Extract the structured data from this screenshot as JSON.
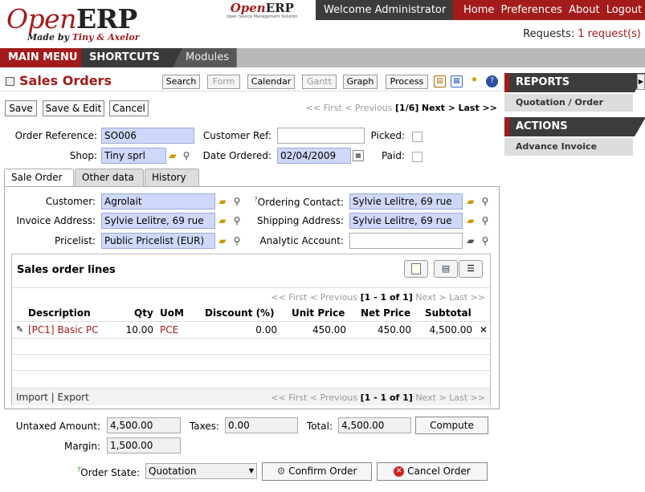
{
  "header": {
    "logo_open": "Open",
    "logo_erp": "ERP",
    "logo_made_by": "Made by ",
    "logo_tiny_axelor": "Tiny & Axelor",
    "mini_logo_open": "Open",
    "mini_logo_erp": "ERP",
    "mini_logo_tagline": "Open Source Management Solution",
    "welcome": "Welcome Administrator",
    "links": [
      "Home",
      "Preferences",
      "About",
      "Logout"
    ],
    "requests_label": "Requests:",
    "requests_value": "1 request(s)"
  },
  "menubar": {
    "main_menu": "MAIN MENU",
    "shortcuts": "SHORTCUTS",
    "modules": "Modules"
  },
  "view": {
    "title": "Sales Orders",
    "view_buttons": [
      "Search",
      "Form",
      "Calendar",
      "Gantt",
      "Graph",
      "Process"
    ],
    "disabled_buttons": [
      "Form",
      "Gantt"
    ]
  },
  "actions": {
    "save": "Save",
    "save_edit": "Save & Edit",
    "cancel": "Cancel",
    "pager_first": "<< First",
    "pager_prev": "< Previous",
    "pager_count": "[1/6]",
    "pager_next": "Next >",
    "pager_last": "Last >>"
  },
  "form": {
    "order_ref_label": "Order Reference:",
    "order_ref": "SO006",
    "customer_ref_label": "Customer Ref:",
    "customer_ref": "",
    "picked_label": "Picked:",
    "shop_label": "Shop:",
    "shop": "Tiny sprl",
    "date_ordered_label": "Date Ordered:",
    "date_ordered": "02/04/2009",
    "paid_label": "Paid:"
  },
  "tabs": [
    "Sale Order",
    "Other data",
    "History"
  ],
  "sale_order": {
    "customer_label": "Customer:",
    "customer": "Agrolait",
    "ordering_contact_label": "Ordering Contact:",
    "ordering_contact": "Sylvie Lelitre, 69 rue",
    "invoice_address_label": "Invoice Address:",
    "invoice_address": "Sylvie Lelitre, 69 rue",
    "shipping_address_label": "Shipping Address:",
    "shipping_address": "Sylvie Lelitre, 69 rue",
    "pricelist_label": "Pricelist:",
    "pricelist": "Public Pricelist (EUR)",
    "analytic_account_label": "Analytic Account:",
    "analytic_account": "",
    "help_mark": "?"
  },
  "lines": {
    "title": "Sales order lines",
    "pager_first": "<< First",
    "pager_prev": "< Previous",
    "pager_count": "[1 - 1 of 1]",
    "pager_next": "Next >",
    "pager_last": "Last >>",
    "columns": [
      "Description",
      "Qty",
      "UoM",
      "Discount (%)",
      "Unit Price",
      "Net Price",
      "Subtotal"
    ],
    "rows": [
      {
        "description": "[PC1] Basic PC",
        "qty": "10.00",
        "uom": "PCE",
        "discount": "0.00",
        "unit_price": "450.00",
        "net_price": "450.00",
        "subtotal": "4,500.00"
      }
    ],
    "import": "Import",
    "sep": "|",
    "export": "Export"
  },
  "totals": {
    "untaxed_label": "Untaxed Amount:",
    "untaxed": "4,500.00",
    "taxes_label": "Taxes:",
    "taxes": "0.00",
    "total_label": "Total:",
    "total": "4,500.00",
    "compute": "Compute",
    "margin_label": "Margin:",
    "margin": "1,500.00",
    "order_state_label": "Order State:",
    "order_state": "Quotation",
    "confirm": "Confirm Order",
    "cancel_order": "Cancel Order",
    "help_mark": "?"
  },
  "sidebar": {
    "reports": "REPORTS",
    "reports_items": [
      "Quotation / Order"
    ],
    "actions": "ACTIONS",
    "actions_items": [
      "Advance Invoice"
    ]
  },
  "colors": {
    "brand_red": "#a31b1b",
    "dark": "#3c3c3c",
    "required_field": "#cfd8f9"
  }
}
